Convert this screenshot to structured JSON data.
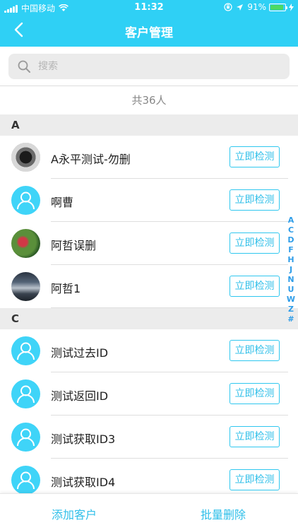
{
  "status_bar": {
    "carrier": "中国移动",
    "time": "11:32",
    "battery_percent": "91%",
    "battery_level": 0.91
  },
  "nav": {
    "back_icon": "chevron-left-icon",
    "title": "客户管理"
  },
  "search": {
    "placeholder": "搜索",
    "icon": "search-icon"
  },
  "count_text": "共36人",
  "sections": [
    {
      "letter": "A",
      "customers": [
        {
          "name": "A永平测试-勿删",
          "avatar": "photo",
          "action": "立即检测"
        },
        {
          "name": "啊曹",
          "avatar": "default",
          "action": "立即检测"
        },
        {
          "name": "阿哲误删",
          "avatar": "photo",
          "action": "立即检测"
        },
        {
          "name": "阿哲1",
          "avatar": "photo",
          "action": "立即检测"
        }
      ]
    },
    {
      "letter": "C",
      "customers": [
        {
          "name": "测试过去ID",
          "avatar": "default",
          "action": "立即检测"
        },
        {
          "name": "测试返回ID",
          "avatar": "default",
          "action": "立即检测"
        },
        {
          "name": "测试获取ID3",
          "avatar": "default",
          "action": "立即检测"
        },
        {
          "name": "测试获取ID4",
          "avatar": "default",
          "action": "立即检测"
        }
      ]
    }
  ],
  "index_letters": [
    "A",
    "C",
    "D",
    "F",
    "H",
    "J",
    "N",
    "U",
    "W",
    "Z",
    "#"
  ],
  "bottom": {
    "add_label": "添加客户",
    "delete_label": "批量删除"
  },
  "colors": {
    "brand": "#2fd0f5",
    "button_text": "#2fbfe9",
    "index_text": "#2f9de8",
    "section_bg": "#ececec"
  }
}
